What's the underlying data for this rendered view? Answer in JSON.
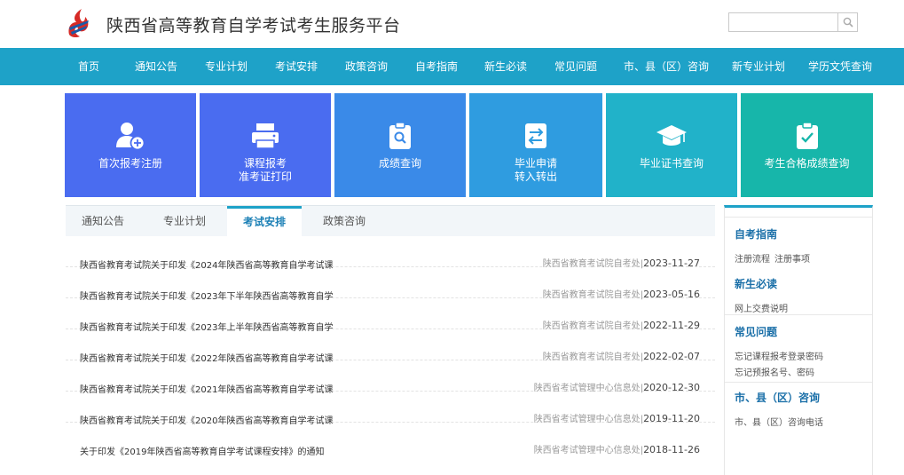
{
  "header": {
    "title": "陕西省高等教育自学考试考生服务平台",
    "search_placeholder": "",
    "logo_icon": "flame-logo-icon",
    "search_icon": "magnifier-icon"
  },
  "nav": {
    "items": [
      {
        "label": "首页"
      },
      {
        "label": "通知公告"
      },
      {
        "label": "专业计划"
      },
      {
        "label": "考试安排"
      },
      {
        "label": "政策咨询"
      },
      {
        "label": "自考指南"
      },
      {
        "label": "新生必读"
      },
      {
        "label": "常见问题"
      },
      {
        "label": "市、县（区）咨询"
      },
      {
        "label": "新专业计划"
      },
      {
        "label": "学历文凭查询"
      }
    ],
    "color": "#1ea2c8"
  },
  "tiles": [
    {
      "line1": "首次报考注册",
      "line2": "",
      "icon": "user-add-icon",
      "color": "#4a6cf0"
    },
    {
      "line1": "课程报考",
      "line2": "准考证打印",
      "icon": "printer-icon",
      "color": "#4a6cf0"
    },
    {
      "line1": "成绩查询",
      "line2": "",
      "icon": "clipboard-search-icon",
      "color": "#3a8ae8"
    },
    {
      "line1": "毕业申请",
      "line2": "转入转出",
      "icon": "transfer-icon",
      "color": "#2f9ce0"
    },
    {
      "line1": "毕业证书查询",
      "line2": "",
      "icon": "graduation-cap-icon",
      "color": "#21b2c9"
    },
    {
      "line1": "考生合格成绩查询",
      "line2": "",
      "icon": "clipboard-check-icon",
      "color": "#17b6aa"
    }
  ],
  "tabs": [
    {
      "label": "通知公告"
    },
    {
      "label": "专业计划"
    },
    {
      "label": "考试安排"
    },
    {
      "label": "政策咨询"
    }
  ],
  "active_tab": "考试安排",
  "news": [
    {
      "title": "陕西省教育考试院关于印发《2024年陕西省高等教育自学考试课",
      "source": "陕西省教育考试院自考处",
      "date": "2023-11-27"
    },
    {
      "title": "陕西省教育考试院关于印发《2023年下半年陕西省高等教育自学",
      "source": "陕西省教育考试院自考处",
      "date": "2023-05-16"
    },
    {
      "title": "陕西省教育考试院关于印发《2023年上半年陕西省高等教育自学",
      "source": "陕西省教育考试院自考处",
      "date": "2022-11-29"
    },
    {
      "title": "陕西省教育考试院关于印发《2022年陕西省高等教育自学考试课",
      "source": "陕西省教育考试院自考处",
      "date": "2022-02-07"
    },
    {
      "title": "陕西省教育考试院关于印发《2021年陕西省高等教育自学考试课",
      "source": "陕西省考试管理中心信息处",
      "date": "2020-12-30"
    },
    {
      "title": "陕西省教育考试院关于印发《2020年陕西省高等教育自学考试课",
      "source": "陕西省考试管理中心信息处",
      "date": "2019-11-20"
    },
    {
      "title": "关于印发《2019年陕西省高等教育自学考试课程安排》的通知",
      "source": "陕西省考试管理中心信息处",
      "date": "2018-11-26"
    }
  ],
  "sidebar": {
    "sections": [
      {
        "heading": "自考指南",
        "links": [
          "注册流程",
          "注册事项"
        ]
      },
      {
        "heading": "新生必读",
        "links": [
          "网上交费说明"
        ]
      },
      {
        "heading": "常见问题",
        "links": [
          "忘记课程报考登录密码",
          "忘记预报名号、密码"
        ]
      },
      {
        "heading": "市、县（区）咨询",
        "links": [
          "市、县（区）咨询电话"
        ]
      }
    ]
  }
}
